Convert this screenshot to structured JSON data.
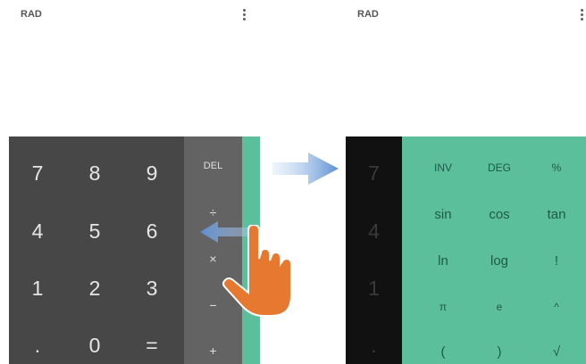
{
  "left_screen": {
    "mode_label": "RAD",
    "menu_icon": "more-vert-icon",
    "number_pad": [
      [
        "7",
        "8",
        "9"
      ],
      [
        "4",
        "5",
        "6"
      ],
      [
        "1",
        "2",
        "3"
      ],
      [
        ".",
        "0",
        "="
      ]
    ],
    "operators": [
      "DEL",
      "÷",
      "×",
      "−",
      "+"
    ]
  },
  "right_screen": {
    "mode_label": "RAD",
    "menu_icon": "more-vert-icon",
    "dimmed_keys": [
      "7",
      "4",
      "1",
      "."
    ],
    "advanced_pad": [
      [
        "INV",
        "DEG",
        "%"
      ],
      [
        "sin",
        "cos",
        "tan"
      ],
      [
        "ln",
        "log",
        "!"
      ],
      [
        "π",
        "e",
        "^"
      ],
      [
        "(",
        ")",
        "√"
      ]
    ]
  },
  "gesture": {
    "hand_icon": "swipe-hand-icon",
    "swipe_arrow_icon": "swipe-left-arrow-icon",
    "transition_arrow_icon": "transition-right-arrow-icon"
  },
  "colors": {
    "number_pad_bg": "#474747",
    "operator_pad_bg": "#636363",
    "advanced_pad_bg": "#5bbf9c",
    "dimmed_pad_bg": "#111111",
    "hand": "#e6782f",
    "swipe_arrow": "#5b8fd2"
  }
}
